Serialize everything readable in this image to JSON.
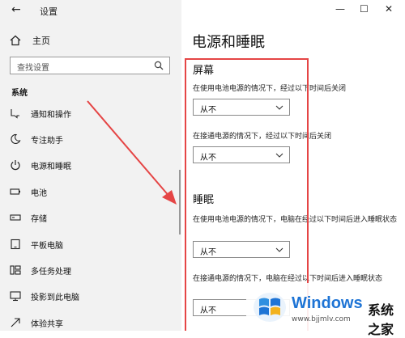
{
  "window": {
    "app_title": "设置",
    "back_glyph": "←",
    "controls": {
      "minimize": "—",
      "maximize": "☐",
      "close": "✕"
    }
  },
  "sidebar": {
    "home_label": "主页",
    "search_placeholder": "查找设置",
    "section_label": "系统",
    "items": [
      {
        "label": "通知和操作",
        "icon": "notification-icon"
      },
      {
        "label": "专注助手",
        "icon": "moon-icon"
      },
      {
        "label": "电源和睡眠",
        "icon": "power-icon",
        "selected": true
      },
      {
        "label": "电池",
        "icon": "battery-icon"
      },
      {
        "label": "存储",
        "icon": "storage-icon"
      },
      {
        "label": "平板电脑",
        "icon": "tablet-icon"
      },
      {
        "label": "多任务处理",
        "icon": "multitask-icon"
      },
      {
        "label": "投影到此电脑",
        "icon": "project-icon"
      },
      {
        "label": "体验共享",
        "icon": "share-icon"
      }
    ]
  },
  "main": {
    "page_title": "电源和睡眠",
    "screen": {
      "title": "屏幕",
      "battery_label": "在使用电池电源的情况下，经过以下时间后关闭",
      "battery_value": "从不",
      "plugged_label": "在接通电源的情况下，经过以下时间后关闭",
      "plugged_value": "从不"
    },
    "sleep": {
      "title": "睡眠",
      "battery_label": "在使用电池电源的情况下，电脑在经过以下时间后进入睡眠状态",
      "battery_value": "从不",
      "plugged_label": "在接通电源的情况下，电脑在经过以下时间后进入睡眠状态",
      "plugged_value": "从不"
    }
  },
  "watermark": {
    "brand": "Windows",
    "sub": "系统之家",
    "url": "www.bjjmlv.com"
  },
  "colors": {
    "accent": "#0078d7",
    "annotation_red": "#e54545",
    "sidebar_bg": "#f2f2f2"
  }
}
